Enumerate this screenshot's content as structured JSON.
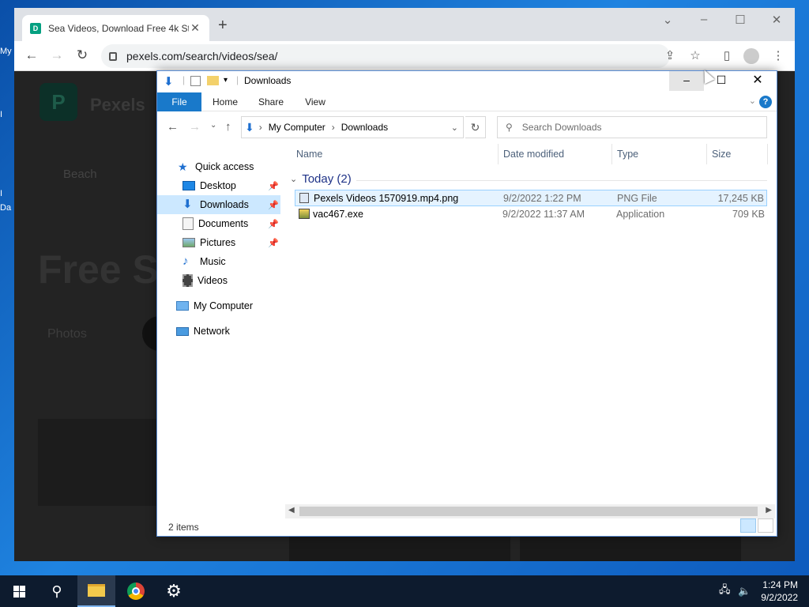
{
  "desktop": {
    "edge_labels": [
      "My",
      "I",
      "I",
      "Da"
    ]
  },
  "browser": {
    "tab_title": "Sea Videos, Download Free 4k St",
    "favicon_letter": "D",
    "url": "pexels.com/search/videos/sea/",
    "page": {
      "brand": "Pexels",
      "brand_letter": "P",
      "chip": "Beach",
      "heading": "Free Se",
      "filter": "Photos"
    }
  },
  "explorer": {
    "title": "Downloads",
    "ribbon_tabs": [
      "File",
      "Home",
      "Share",
      "View"
    ],
    "breadcrumb": [
      "My Computer",
      "Downloads"
    ],
    "search_placeholder": "Search Downloads",
    "nav": [
      {
        "label": "Quick access",
        "icon": "star-icon",
        "pinned": false
      },
      {
        "label": "Desktop",
        "icon": "desktop-icon",
        "pinned": true
      },
      {
        "label": "Downloads",
        "icon": "download-arrow-icon",
        "pinned": true,
        "selected": true
      },
      {
        "label": "Documents",
        "icon": "documents-icon",
        "pinned": true
      },
      {
        "label": "Pictures",
        "icon": "pictures-icon",
        "pinned": true
      },
      {
        "label": "Music",
        "icon": "music-icon",
        "pinned": false
      },
      {
        "label": "Videos",
        "icon": "videos-icon",
        "pinned": false
      },
      {
        "label": "My Computer",
        "icon": "computer-icon",
        "pinned": false
      },
      {
        "label": "Network",
        "icon": "network-icon",
        "pinned": false
      }
    ],
    "columns": [
      "Name",
      "Date modified",
      "Type",
      "Size"
    ],
    "group_label": "Today (2)",
    "files": [
      {
        "name": "Pexels Videos 1570919.mp4.png",
        "date": "9/2/2022 1:22 PM",
        "type": "PNG File",
        "size": "17,245 KB",
        "icon": "png-file-icon"
      },
      {
        "name": "vac467.exe",
        "date": "9/2/2022 11:37 AM",
        "type": "Application",
        "size": "709 KB",
        "icon": "exe-file-icon"
      }
    ],
    "status": "2 items"
  },
  "taskbar": {
    "time": "1:24 PM",
    "date": "9/2/2022"
  }
}
